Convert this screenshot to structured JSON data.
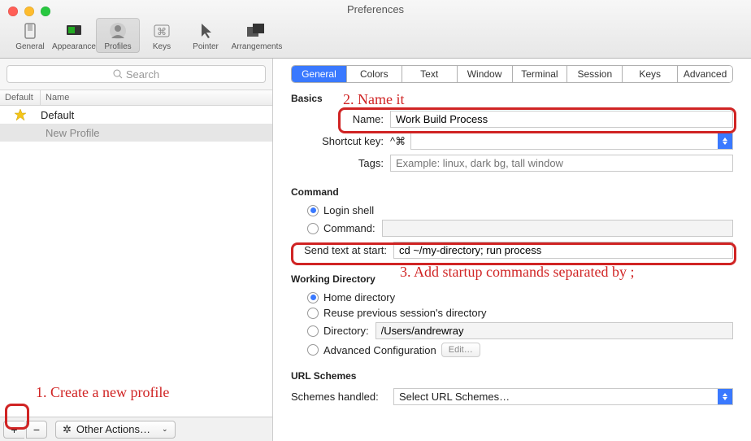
{
  "window": {
    "title": "Preferences"
  },
  "toolbar": {
    "items": [
      "General",
      "Appearance",
      "Profiles",
      "Keys",
      "Pointer",
      "Arrangements"
    ],
    "active": 2
  },
  "sidebar": {
    "search_placeholder": "Search",
    "columns": {
      "default": "Default",
      "name": "Name"
    },
    "rows": [
      {
        "name": "Default",
        "is_default": true
      },
      {
        "name": "New Profile",
        "is_default": false,
        "new": true
      }
    ],
    "footer": {
      "add": "+",
      "remove": "−",
      "other": "Other Actions…"
    }
  },
  "tabs": [
    "General",
    "Colors",
    "Text",
    "Window",
    "Terminal",
    "Session",
    "Keys",
    "Advanced"
  ],
  "basics": {
    "title": "Basics",
    "name_label": "Name:",
    "name_value": "Work Build Process",
    "shortcut_label": "Shortcut key:",
    "shortcut_hint": "^⌘",
    "tags_label": "Tags:",
    "tags_placeholder": "Example: linux, dark bg, tall window"
  },
  "command": {
    "title": "Command",
    "login_shell": "Login shell",
    "command_label": "Command:",
    "send_label": "Send text at start:",
    "send_value": "cd ~/my-directory; run process"
  },
  "workdir": {
    "title": "Working Directory",
    "home": "Home directory",
    "reuse": "Reuse previous session's directory",
    "dir_label": "Directory:",
    "dir_value": "/Users/andrewray",
    "adv": "Advanced Configuration",
    "edit": "Edit…"
  },
  "url": {
    "title": "URL Schemes",
    "label": "Schemes handled:",
    "value": "Select URL Schemes…"
  },
  "annotations": {
    "a1": "1. Create a new profile",
    "a2": "2. Name it",
    "a3": "3. Add startup commands separated by ;"
  }
}
